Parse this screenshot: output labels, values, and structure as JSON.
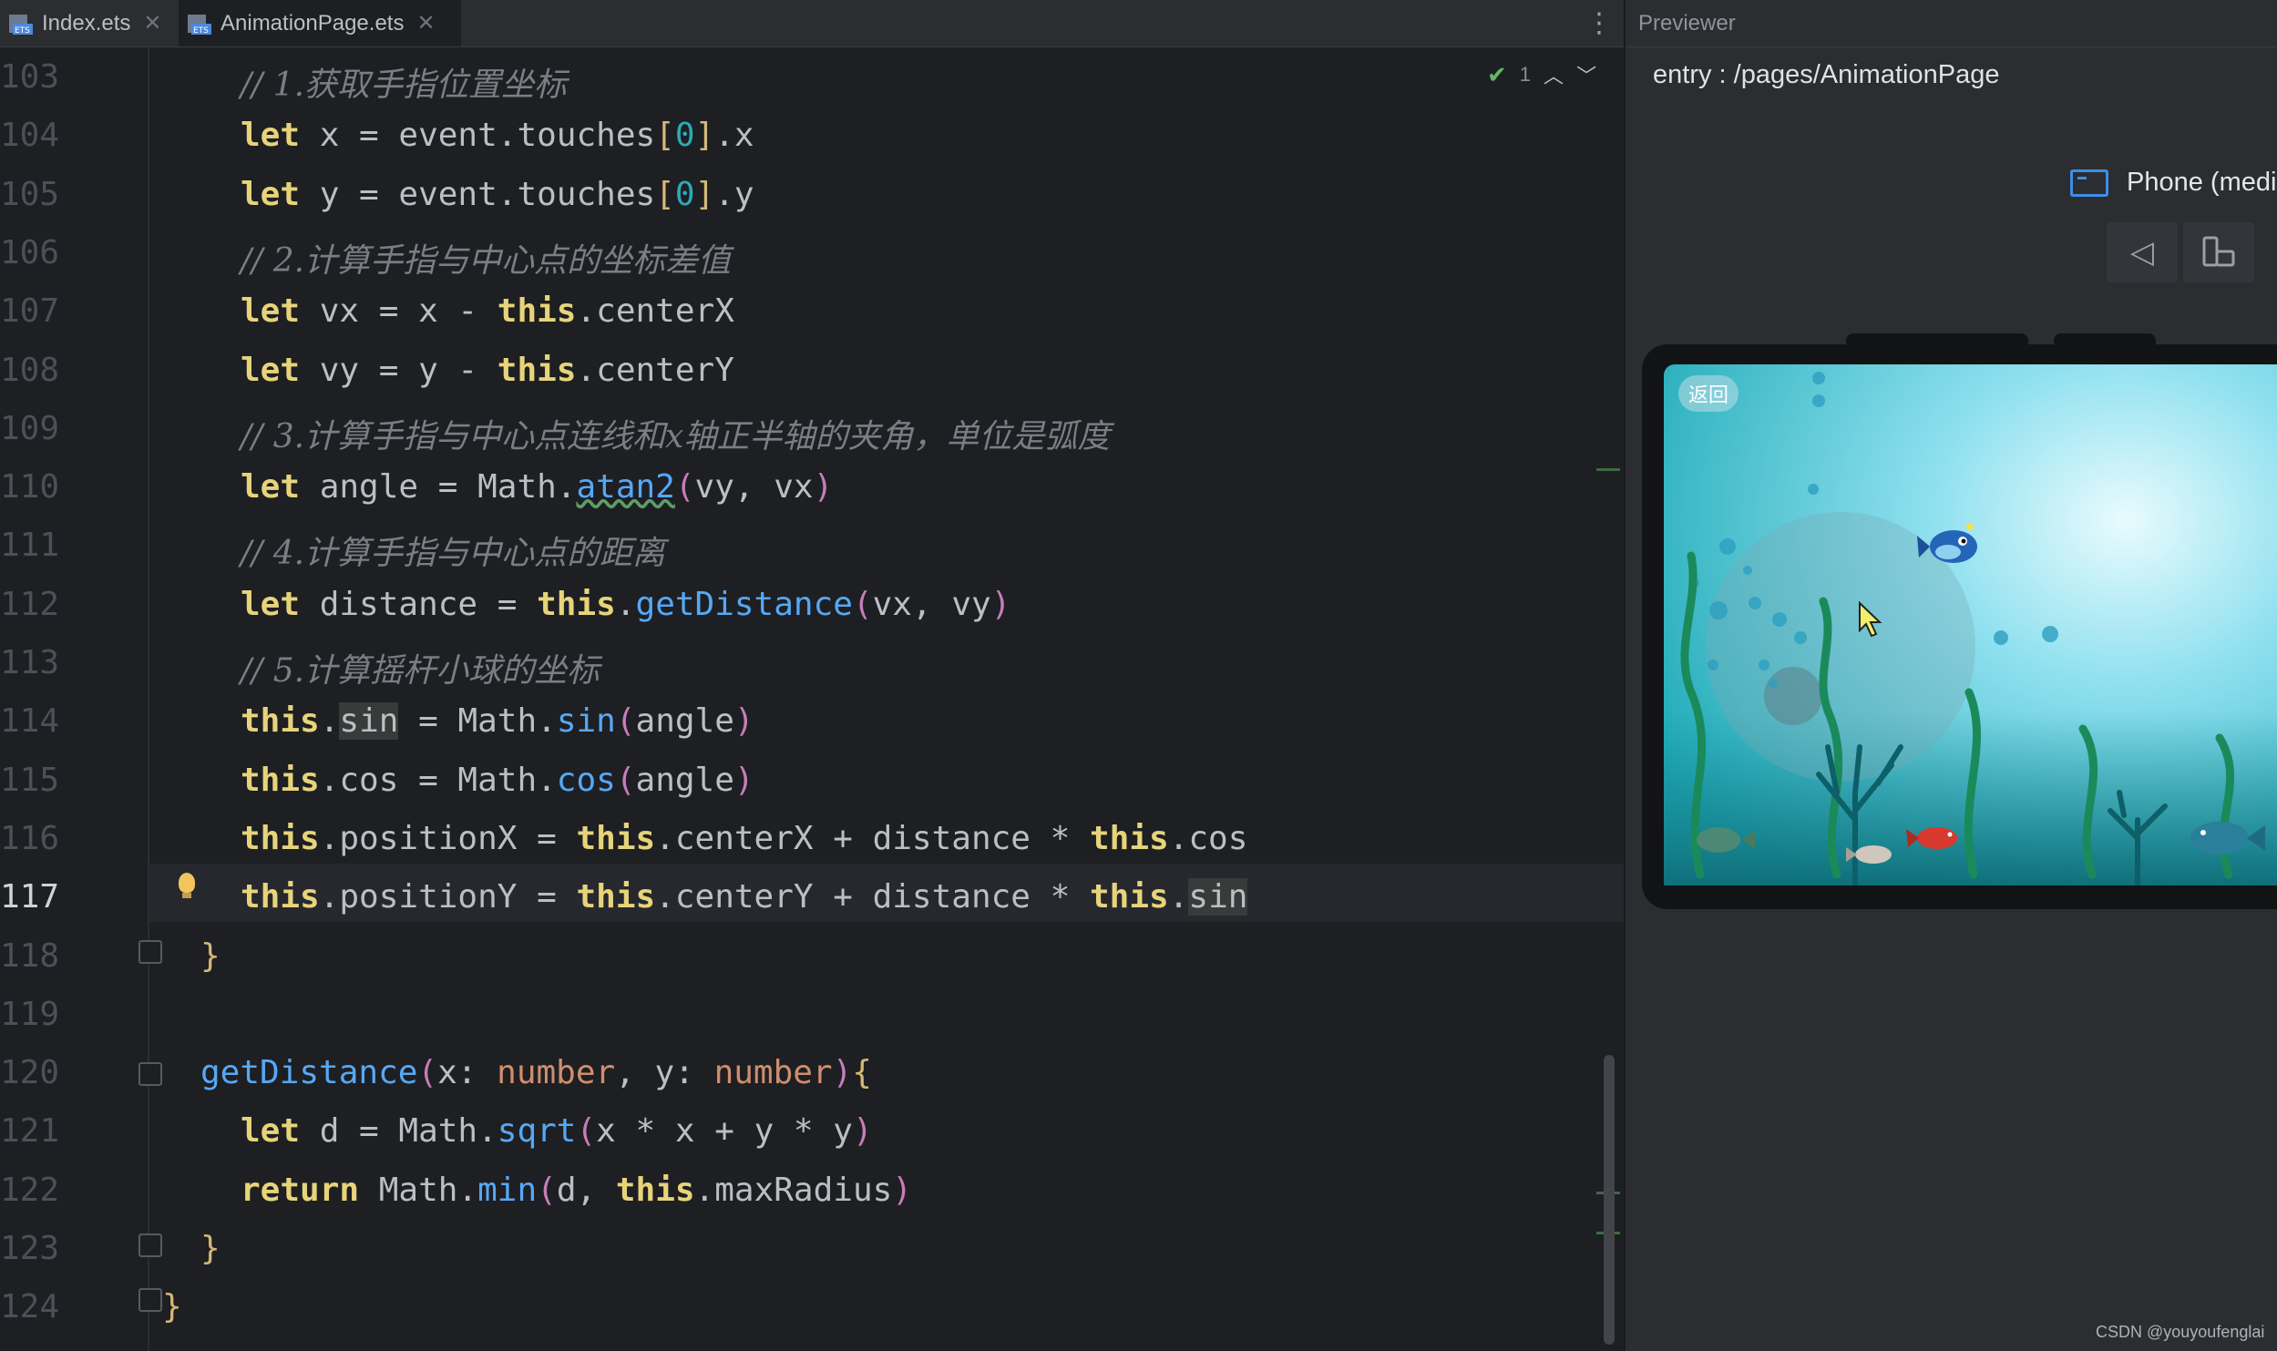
{
  "tabs": [
    {
      "label": "Index.ets",
      "icon": "ets-file-icon",
      "active": false
    },
    {
      "label": "AnimationPage.ets",
      "icon": "ets-file-icon",
      "active": true
    }
  ],
  "editor": {
    "inspection_count": "1",
    "current_line": 117,
    "lines": [
      {
        "n": "103",
        "html": "<span class=\"cm\">// 1.获取手指位置坐标</span>"
      },
      {
        "n": "104",
        "html": "<span class=\"kwb\">let</span> x = event.touches<span class=\"br\">[</span><span class=\"num\">0</span><span class=\"br\">]</span>.x"
      },
      {
        "n": "105",
        "html": "<span class=\"kwb\">let</span> y = event.touches<span class=\"br\">[</span><span class=\"num\">0</span><span class=\"br\">]</span>.y"
      },
      {
        "n": "106",
        "html": "<span class=\"cm\">// 2.计算手指与中心点的坐标差值</span>"
      },
      {
        "n": "107",
        "html": "<span class=\"kwb\">let</span> vx = x - <span class=\"kwb\">this</span>.centerX"
      },
      {
        "n": "108",
        "html": "<span class=\"kwb\">let</span> vy = y - <span class=\"kwb\">this</span>.centerY"
      },
      {
        "n": "109",
        "html": "<span class=\"cm\">// 3.计算手指与中心点连线和x轴正半轴的夹角，单位是弧度</span>"
      },
      {
        "n": "110",
        "html": "<span class=\"kwb\">let</span> angle = Math.<span class=\"fn\" style=\"text-decoration:underline wavy #5c9e6a\">atan2</span><span class=\"brp\">(</span>vy, vx<span class=\"brp\">)</span>"
      },
      {
        "n": "111",
        "html": "<span class=\"cm\">// 4.计算手指与中心点的距离</span>"
      },
      {
        "n": "112",
        "html": "<span class=\"kwb\">let</span> distance = <span class=\"kwb\">this</span>.<span class=\"fn\">getDistance</span><span class=\"brp\">(</span>vx, vy<span class=\"brp\">)</span>"
      },
      {
        "n": "113",
        "html": "<span class=\"cm\">// 5.计算摇杆小球的坐标</span>"
      },
      {
        "n": "114",
        "html": "<span class=\"kwb\">this</span>.<span class=\"hl\">sin</span> = Math.<span class=\"fn\">sin</span><span class=\"brp\">(</span>angle<span class=\"brp\">)</span>"
      },
      {
        "n": "115",
        "html": "<span class=\"kwb\">this</span>.cos = Math.<span class=\"fn\">cos</span><span class=\"brp\">(</span>angle<span class=\"brp\">)</span>"
      },
      {
        "n": "116",
        "html": "<span class=\"kwb\">this</span>.positionX = <span class=\"kwb\">this</span>.centerX + distance * <span class=\"kwb\">this</span>.cos"
      },
      {
        "n": "117",
        "html": "<span class=\"kwb\">this</span>.positionY = <span class=\"kwb\">this</span>.centerY + distance * <span class=\"kwb\">this</span>.<span class=\"hl\">sin</span>"
      },
      {
        "n": "118",
        "html": "<span class=\"br\">}</span>"
      },
      {
        "n": "119",
        "html": ""
      },
      {
        "n": "120",
        "html": "<span class=\"fn\">getDistance</span><span class=\"brp\">(</span>x: <span class=\"type\">number</span>, y: <span class=\"type\">number</span><span class=\"brp\">)</span><span class=\"br\">{</span>"
      },
      {
        "n": "121",
        "html": "<span class=\"kwb\">let</span> d = Math.<span class=\"fn\">sqrt</span><span class=\"brp\">(</span>x * x + y * y<span class=\"brp\">)</span>"
      },
      {
        "n": "122",
        "html": "<span class=\"kwb\">return</span> Math.<span class=\"fn\">min</span><span class=\"brp\">(</span>d, <span class=\"kwb\">this</span>.maxRadius<span class=\"brp\">)</span>"
      },
      {
        "n": "123",
        "html": "<span class=\"br\">}</span>"
      },
      {
        "n": "124",
        "html": "<span class=\"br\">}</span>"
      }
    ]
  },
  "previewer": {
    "title": "Previewer",
    "route": "entry : /pages/AnimationPage",
    "device_label": "Phone (medi",
    "back_button_label": "返回"
  },
  "watermark": "CSDN @youyoufenglai",
  "colors": {
    "editor_bg": "#1e1f22",
    "keyword": "#e7d47a",
    "function": "#56a8f5",
    "comment": "#7a7e85",
    "ocean_top": "#8fe0ef",
    "ocean_bottom": "#1aa8b4"
  }
}
